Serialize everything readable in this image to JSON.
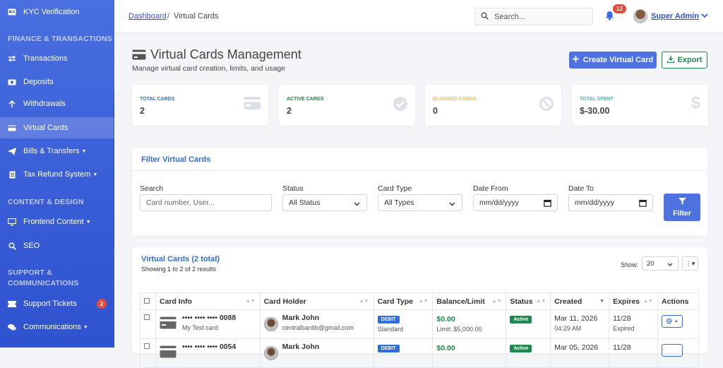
{
  "sidebar": {
    "items": [
      {
        "label": "KYC Verification",
        "icon": "id-card-icon"
      },
      {
        "label": "Transactions",
        "icon": "exchange-icon"
      },
      {
        "label": "Deposits",
        "icon": "money-icon"
      },
      {
        "label": "Withdrawals",
        "icon": "arrow-up-icon"
      },
      {
        "label": "Virtual Cards",
        "icon": "credit-card-icon",
        "active": true
      },
      {
        "label": "Bills & Transfers",
        "icon": "paper-plane-icon",
        "dropdown": true
      },
      {
        "label": "Tax Refund System",
        "icon": "file-icon",
        "dropdown": true
      },
      {
        "label": "Frontend Content",
        "icon": "desktop-icon",
        "dropdown": true
      },
      {
        "label": "SEO",
        "icon": "search-icon"
      },
      {
        "label": "Support Tickets",
        "icon": "ticket-icon",
        "badge": "2"
      },
      {
        "label": "Communications",
        "icon": "comments-icon",
        "dropdown": true
      }
    ],
    "headings": {
      "finance": "FINANCE & TRANSACTIONS",
      "content": "CONTENT & DESIGN",
      "support_line1": "SUPPORT &",
      "support_line2": "COMMUNICATIONS"
    }
  },
  "topbar": {
    "breadcrumb_link": "Dashboard",
    "breadcrumb_sep": "/",
    "breadcrumb_current": "Virtual Cards",
    "search_placeholder": "Search...",
    "notification_count": "12",
    "user_name": "Super Admin"
  },
  "header": {
    "title": "Virtual Cards Management",
    "subtitle": "Manage virtual card creation, limits, and usage",
    "create_label": "Create Virtual Card",
    "export_label": "Export"
  },
  "stats": [
    {
      "label": "TOTAL CARDS",
      "value": "2",
      "color": "#2f6de0",
      "icon": "credit-card-icon"
    },
    {
      "label": "ACTIVE CARDS",
      "value": "2",
      "color": "#1b8a4c",
      "icon": "check-circle-icon"
    },
    {
      "label": "BLOCKED CARDS",
      "value": "0",
      "color": "#f6c23e",
      "icon": "ban-icon"
    },
    {
      "label": "TOTAL SPENT",
      "value": "$-30.00",
      "color": "#36b9cc",
      "icon": "dollar-icon"
    }
  ],
  "filters": {
    "title": "Filter Virtual Cards",
    "search_label": "Search",
    "search_placeholder": "Card number, User...",
    "status_label": "Status",
    "status_value": "All Status",
    "type_label": "Card Type",
    "type_value": "All Types",
    "from_label": "Date From",
    "from_value": "mm/dd/yyyy",
    "to_label": "Date To",
    "to_value": "mm/dd/yyyy",
    "button_label": "Filter"
  },
  "list": {
    "title": "Virtual Cards (2 total)",
    "subtitle": "Showing 1 to 2 of 2 results",
    "show_label": "Show:",
    "show_value": "20",
    "columns": [
      "Card Info",
      "Card Holder",
      "Card Type",
      "Balance/Limit",
      "Status",
      "Created",
      "Expires",
      "Actions"
    ],
    "rows": [
      {
        "card_number": "•••• •••• •••• 0088",
        "card_name": "My Test card",
        "holder_name": "Mark John",
        "holder_email": "centralbanlib@gmail.com",
        "type": "DEBIT",
        "tier": "Standard",
        "balance": "$0.00",
        "limit": "Limit: $5,000.00",
        "status": "Active",
        "created_date": "Mar 11, 2026",
        "created_time": "04:29 AM",
        "expires": "11/28",
        "expires_status": "Expired"
      },
      {
        "card_number": "•••• •••• •••• 0054",
        "card_name": "",
        "holder_name": "Mark John",
        "holder_email": "",
        "type": "DEBIT",
        "tier": "",
        "balance": "$0.00",
        "limit": "",
        "status": "Active",
        "created_date": "Mar 05, 2026",
        "created_time": "",
        "expires": "11/28",
        "expires_status": ""
      }
    ]
  }
}
